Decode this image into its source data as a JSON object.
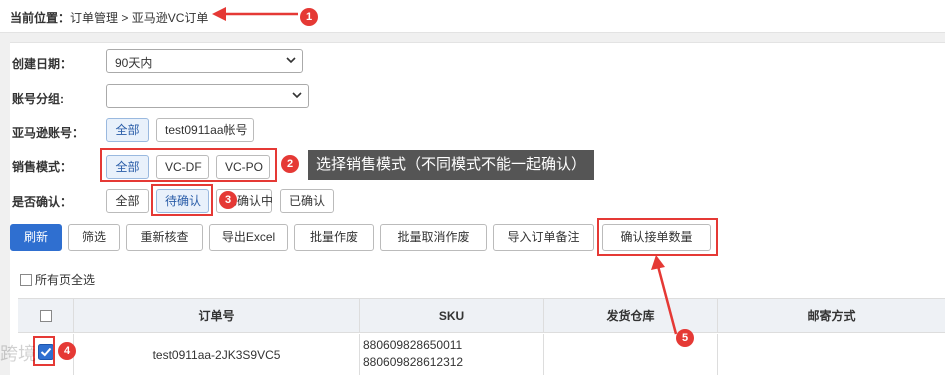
{
  "breadcrumb": {
    "prefix": "当前位置：",
    "path": "订单管理 > 亚马逊VC订单"
  },
  "filters": {
    "created_label": "创建日期：",
    "created_value": "90天内",
    "group_label": "账号分组:",
    "group_value": "",
    "account_label": "亚马逊账号：",
    "account_options": [
      "全部",
      "test0911aa帐号"
    ],
    "sales_label": "销售模式：",
    "sales_options": [
      "全部",
      "VC-DF",
      "VC-PO"
    ],
    "confirm_label": "是否确认：",
    "confirm_options": [
      "全部",
      "待确认",
      "已确认中",
      "已确认"
    ]
  },
  "annotations": {
    "badges": [
      "1",
      "2",
      "3",
      "5",
      "4"
    ],
    "tip": "选择销售模式（不同模式不能一起确认）"
  },
  "toolbar": {
    "buttons": [
      "刷新",
      "筛选",
      "重新核查",
      "导出Excel",
      "批量作废",
      "批量取消作废",
      "导入订单备注",
      "确认接单数量"
    ]
  },
  "select_all_label": "所有页全选",
  "table": {
    "headers": [
      "订单号",
      "SKU",
      "发货仓库",
      "邮寄方式"
    ],
    "rows": [
      {
        "order_no": "test0911aa-2JK3S9VC5",
        "sku_1": "880609828650011",
        "sku_2": "880609828612312",
        "warehouse": "",
        "shipping": ""
      }
    ]
  },
  "watermark": "跨境",
  "colors": {
    "primary": "#2f6fd0",
    "annotation_red": "#e53935"
  }
}
